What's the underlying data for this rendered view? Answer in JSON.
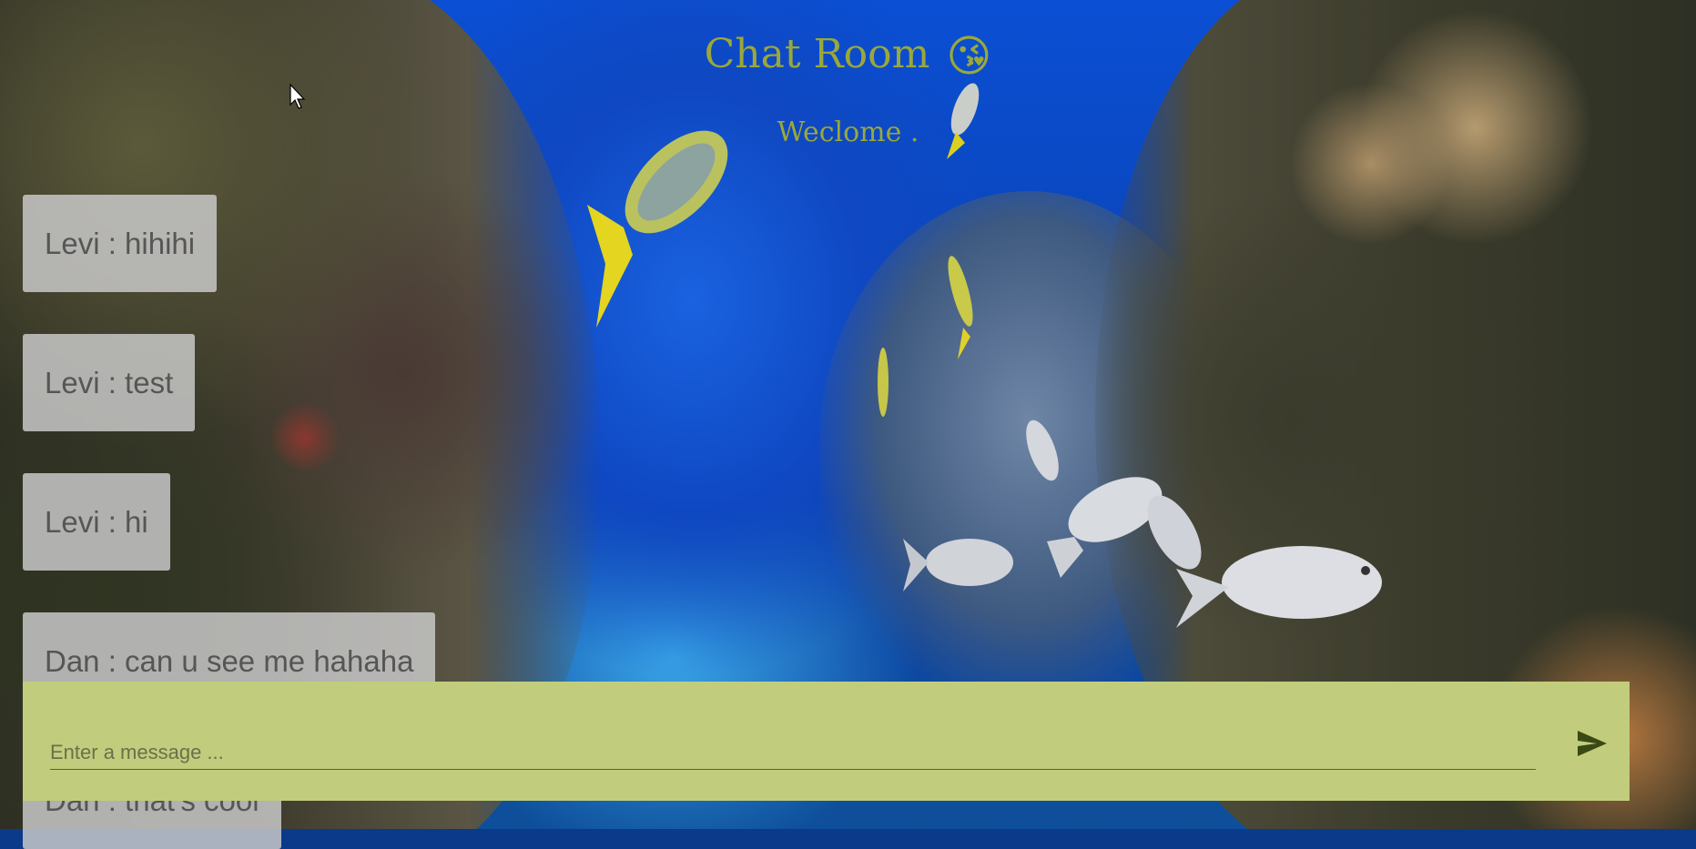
{
  "header": {
    "title": "Chat Room",
    "title_emoji": "😘",
    "welcome": "Weclome ."
  },
  "messages": [
    {
      "text": "Levi : hihihi"
    },
    {
      "text": "Levi : test"
    },
    {
      "text": "Levi : hi"
    },
    {
      "text": "Dan : can u see me hahaha"
    },
    {
      "text": "Dan : that's cool"
    }
  ],
  "composer": {
    "placeholder": "Enter a message ...",
    "value": "",
    "send_icon": "send-icon"
  },
  "colors": {
    "title": "#9aa83a",
    "composer_bg": "#c1cd7c",
    "bubble_bg": "#c8c8c8",
    "send_icon": "#3a4a14"
  }
}
